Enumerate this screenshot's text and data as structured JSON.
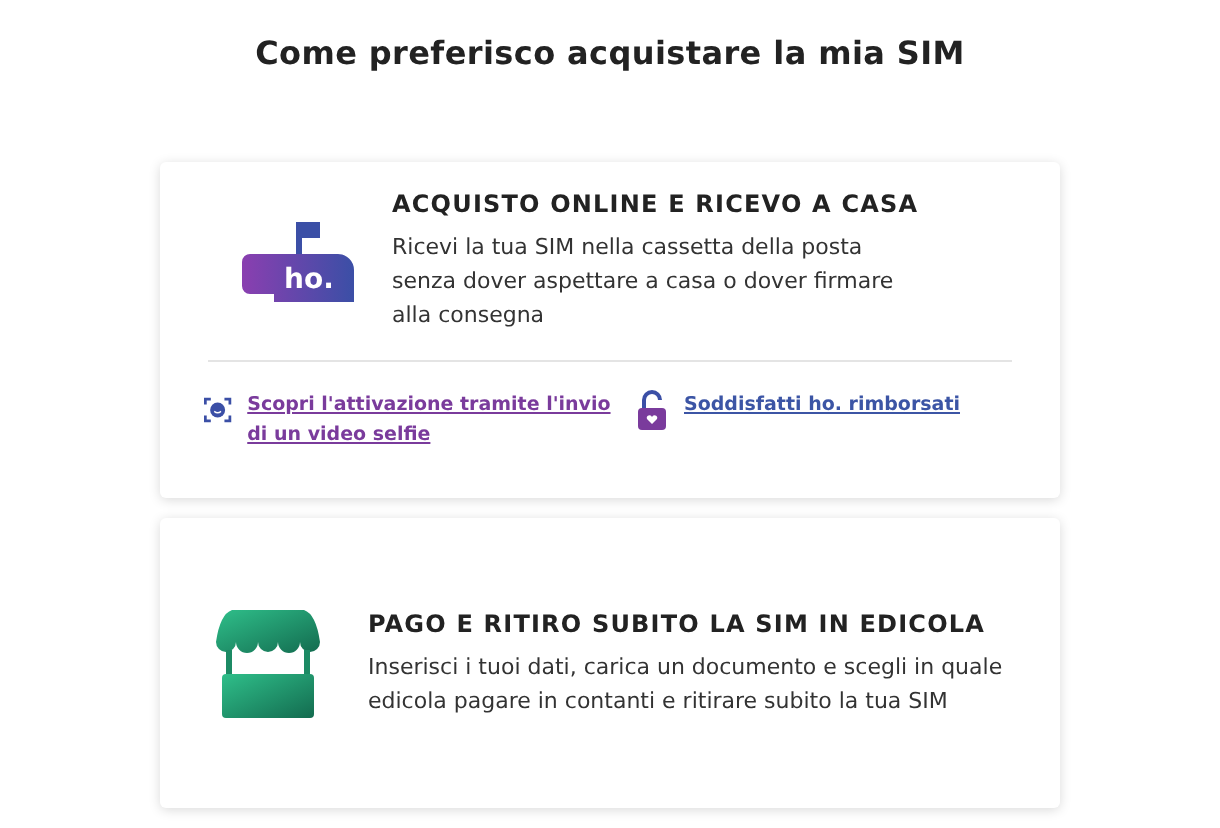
{
  "title": "Come preferisco acquistare la mia SIM",
  "options": [
    {
      "kind": "mailbox",
      "logo_text": "ho.",
      "heading": "ACQUISTO ONLINE E RICEVO A CASA",
      "text": "Ricevi la tua SIM nella cassetta della posta senza dover aspettare a casa o dover firmare alla consegna",
      "links": [
        {
          "kind": "selfie",
          "label": "Scopri l'attivazione tramite l'invio di un video selfie",
          "color": "#7a3b9c"
        },
        {
          "kind": "lock",
          "label": "Soddisfatti ho. rimborsati",
          "color": "#3c55a5"
        }
      ]
    },
    {
      "kind": "kiosk",
      "heading": "PAGO E RITIRO SUBITO LA SIM IN EDICOLA",
      "text": "Inserisci i tuoi dati, carica un documento e scegli in quale edicola pagare in contanti e ritirare subito la tua SIM"
    }
  ]
}
